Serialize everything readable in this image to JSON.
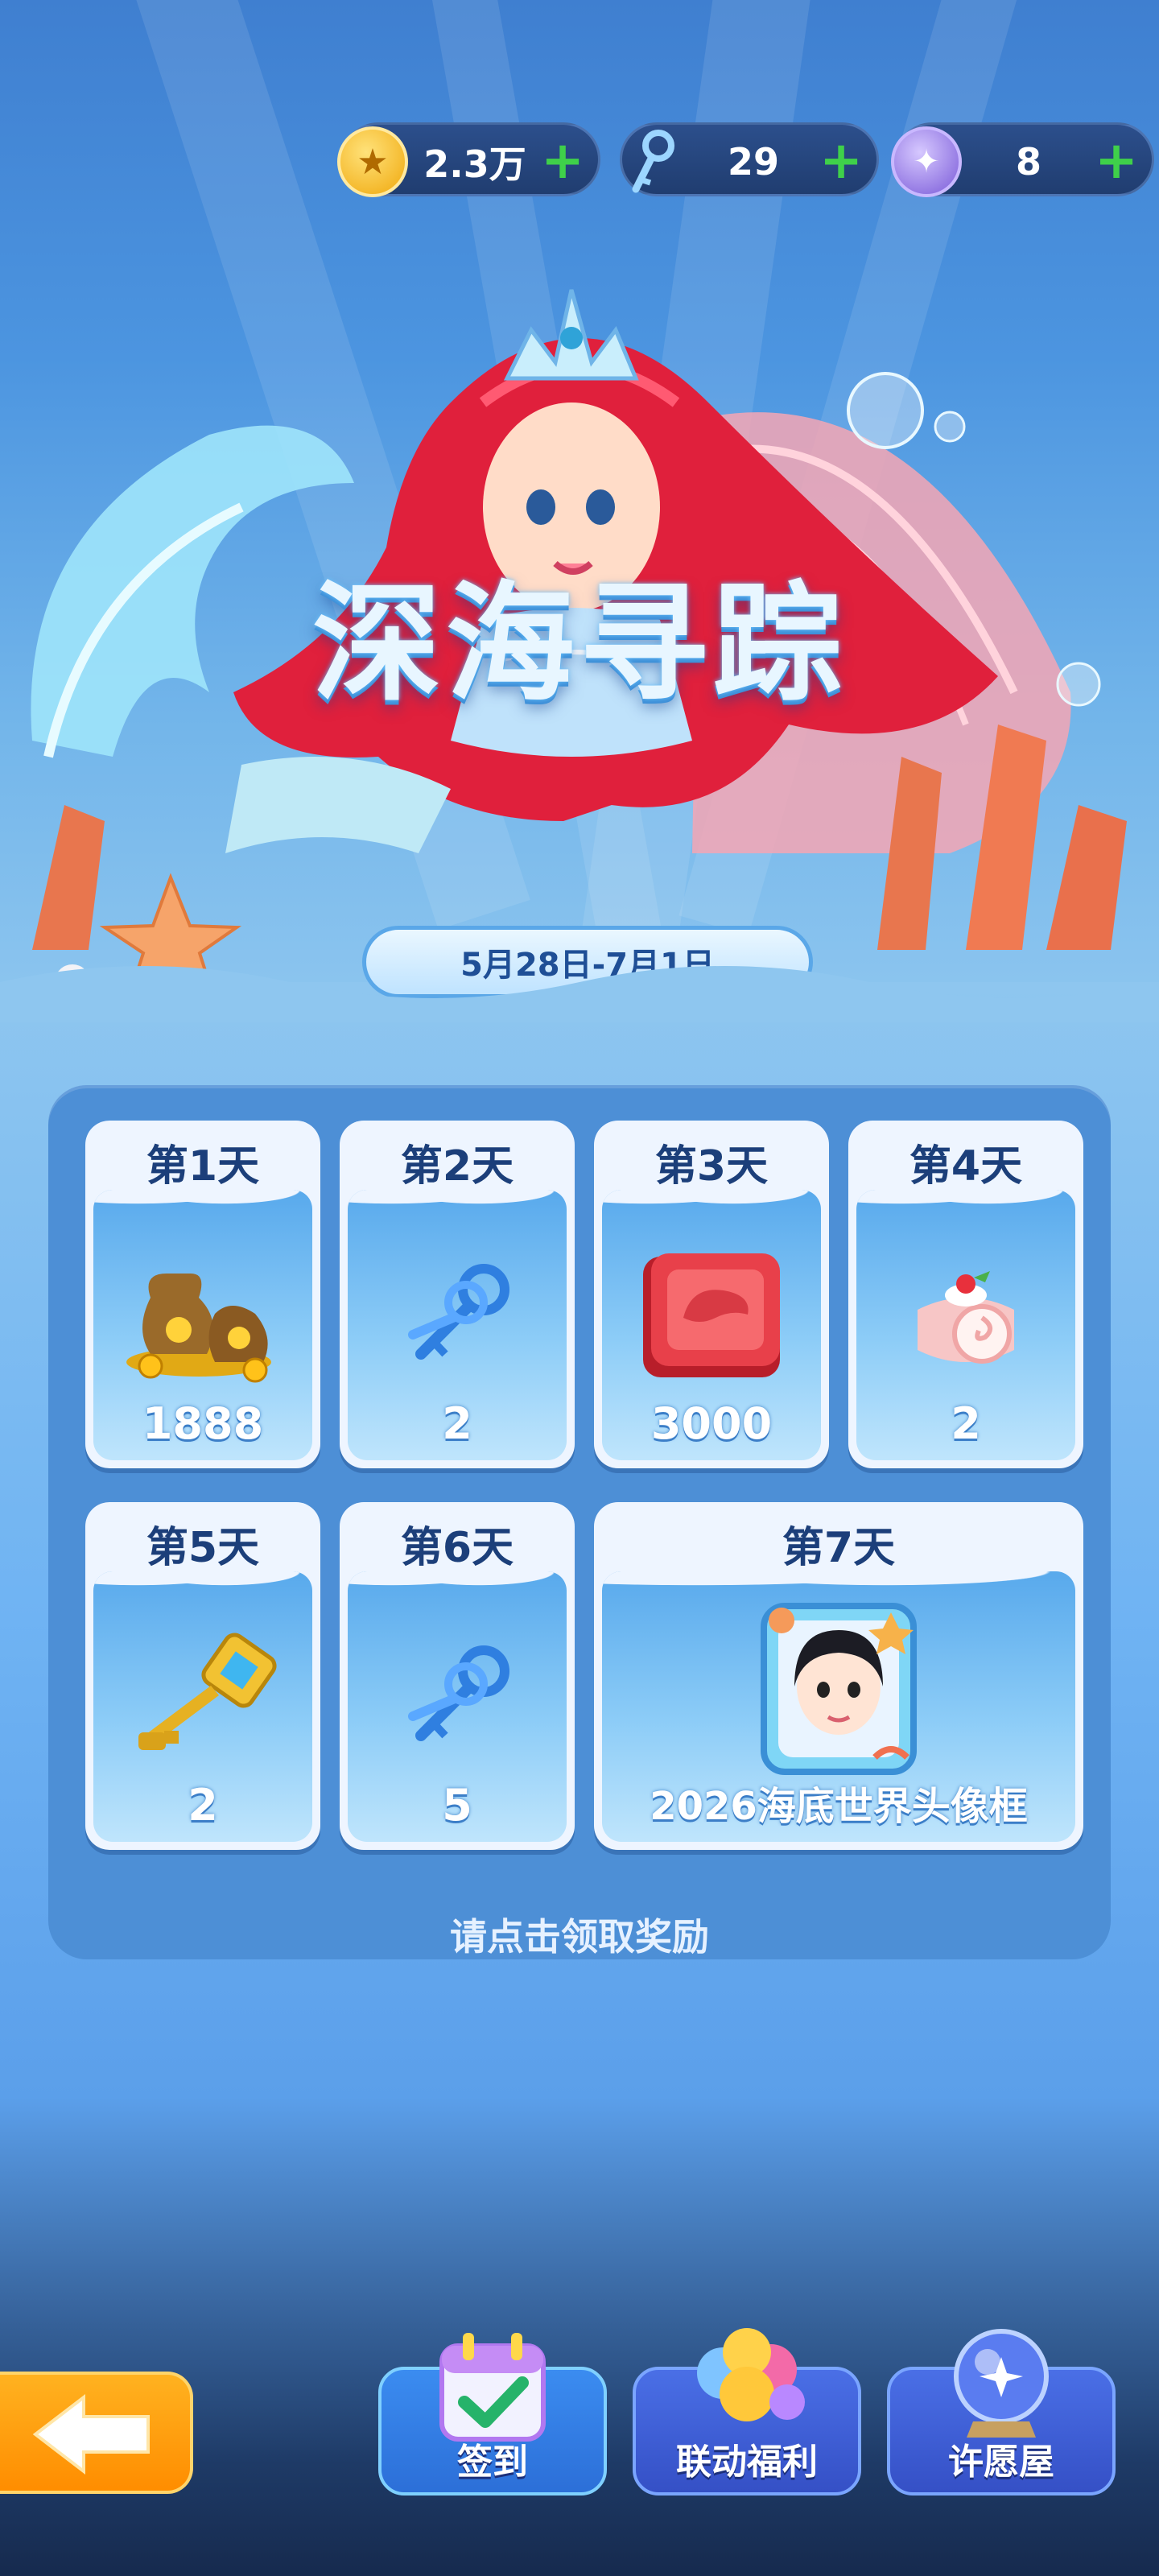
{
  "currencies": [
    {
      "icon": "gold-coin-icon",
      "value": "2.3万",
      "color": "#f6c21c"
    },
    {
      "icon": "key-icon",
      "value": "29",
      "color": "#7cc4ff"
    },
    {
      "icon": "wish-orb-icon",
      "value": "8",
      "color": "#a08cf0"
    }
  ],
  "event": {
    "title": "深海寻踪",
    "date_range": "5月28日-7月1日"
  },
  "rewards": [
    {
      "day": "第1天",
      "item": "coin-bags-icon",
      "qty": "1888"
    },
    {
      "day": "第2天",
      "item": "blue-keys-icon",
      "qty": "2"
    },
    {
      "day": "第3天",
      "item": "red-badge-icon",
      "qty": "3000"
    },
    {
      "day": "第4天",
      "item": "cake-roll-icon",
      "qty": "2"
    },
    {
      "day": "第5天",
      "item": "golden-key-icon",
      "qty": "2"
    },
    {
      "day": "第6天",
      "item": "blue-keys-icon",
      "qty": "5"
    },
    {
      "day": "第7天",
      "item": "avatar-frame-icon",
      "qty": "2026海底世界头像框"
    }
  ],
  "hint": "请点击领取奖励",
  "nav": {
    "checkin": "签到",
    "collab": "联动福利",
    "wish": "许愿屋"
  },
  "colors": {
    "panel": "#4d8fd6",
    "card": "#eef5ff",
    "back_button": "#ff9a10",
    "plus": "#3fd04a"
  }
}
